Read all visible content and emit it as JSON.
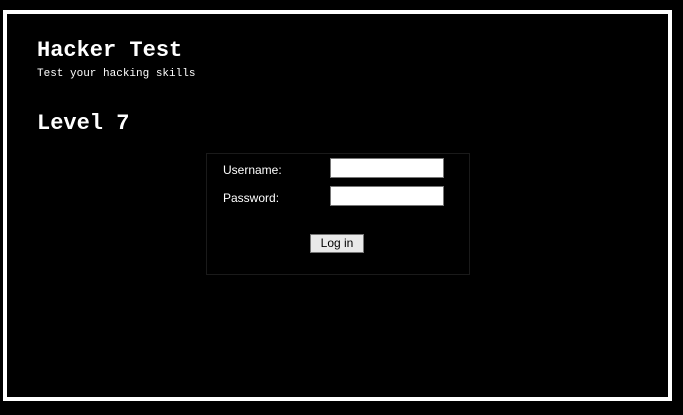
{
  "header": {
    "title": "Hacker Test",
    "subtitle": "Test your hacking skills"
  },
  "level": {
    "title": "Level 7"
  },
  "login_form": {
    "username_label": "Username:",
    "username_value": "",
    "password_label": "Password:",
    "password_value": "",
    "submit_label": "Log in"
  },
  "colors": {
    "background": "#000000",
    "frame_border": "#ffffff",
    "text": "#ffffff",
    "button_bg": "#e9e9e9"
  }
}
